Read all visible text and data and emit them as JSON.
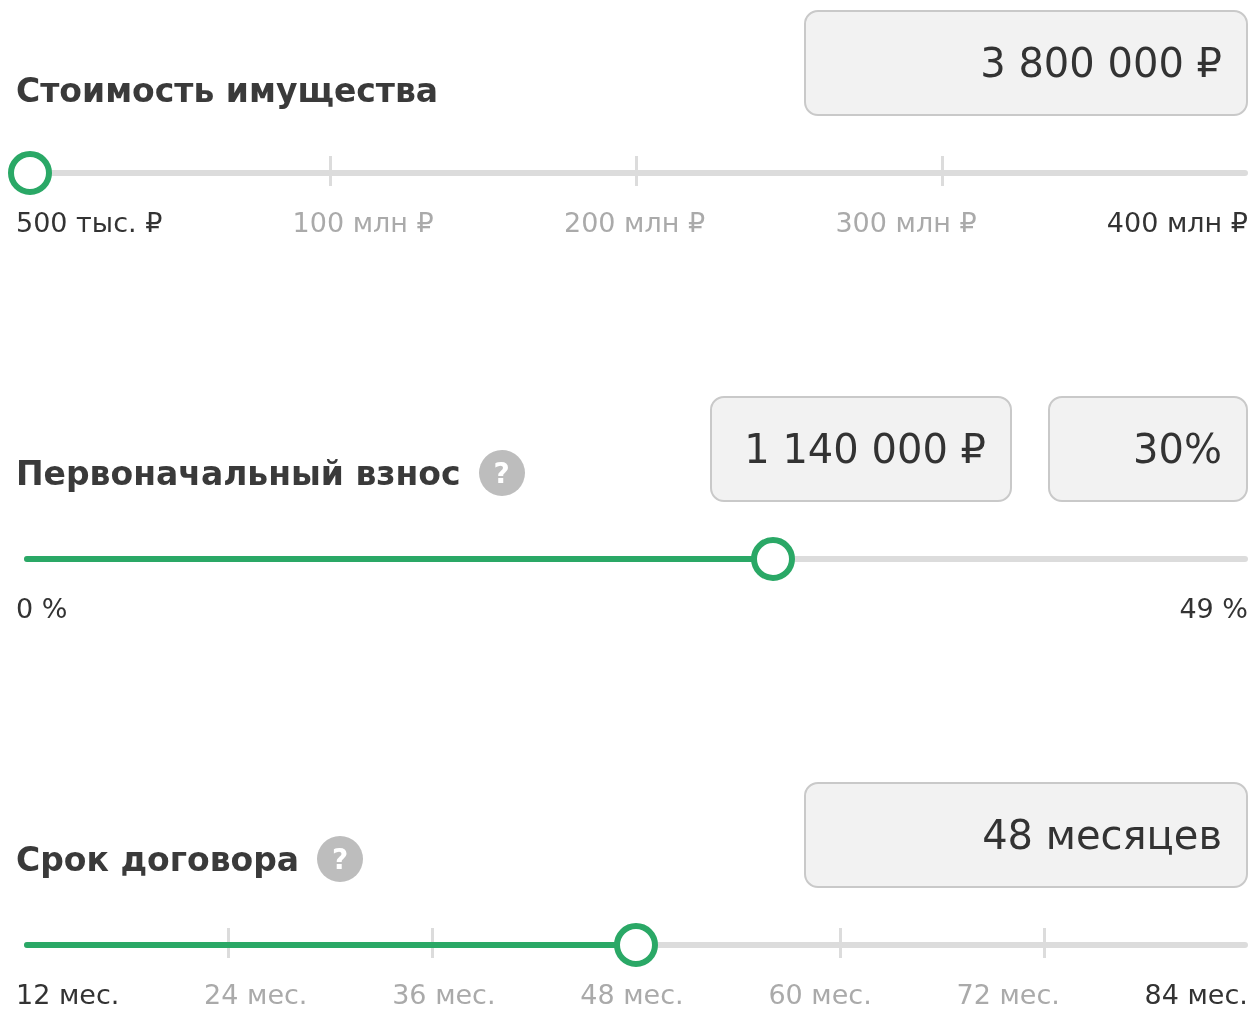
{
  "sliders": [
    {
      "label": "Стоимость имущества",
      "fields": [
        "3 800 000 ₽"
      ],
      "level": 0.005,
      "labels": [
        {
          "text": "500 тыс. ₽",
          "muted": false
        },
        {
          "text": "100 млн ₽",
          "muted": true
        },
        {
          "text": "200 млн ₽",
          "muted": true
        },
        {
          "text": "300 млн ₽",
          "muted": true
        },
        {
          "text": "400 млн ₽",
          "muted": false
        }
      ]
    },
    {
      "label": "Первоначальный взнос",
      "help": "?",
      "fields": [
        "1 140 000 ₽",
        "30%"
      ],
      "level": 0.612,
      "labels": [
        {
          "text": "0 %",
          "muted": false
        },
        {
          "text": "49 %",
          "muted": false
        }
      ]
    },
    {
      "label": "Срок договора",
      "help": "?",
      "fields": [
        "48 месяцев"
      ],
      "level": 0.5,
      "labels": [
        {
          "text": "12 мес.",
          "muted": false
        },
        {
          "text": "24 мес.",
          "muted": true
        },
        {
          "text": "36 мес.",
          "muted": true
        },
        {
          "text": "48 мес.",
          "muted": true
        },
        {
          "text": "60 мес.",
          "muted": true
        },
        {
          "text": "72 мес.",
          "muted": true
        },
        {
          "text": "84 мес.",
          "muted": false
        }
      ]
    }
  ]
}
